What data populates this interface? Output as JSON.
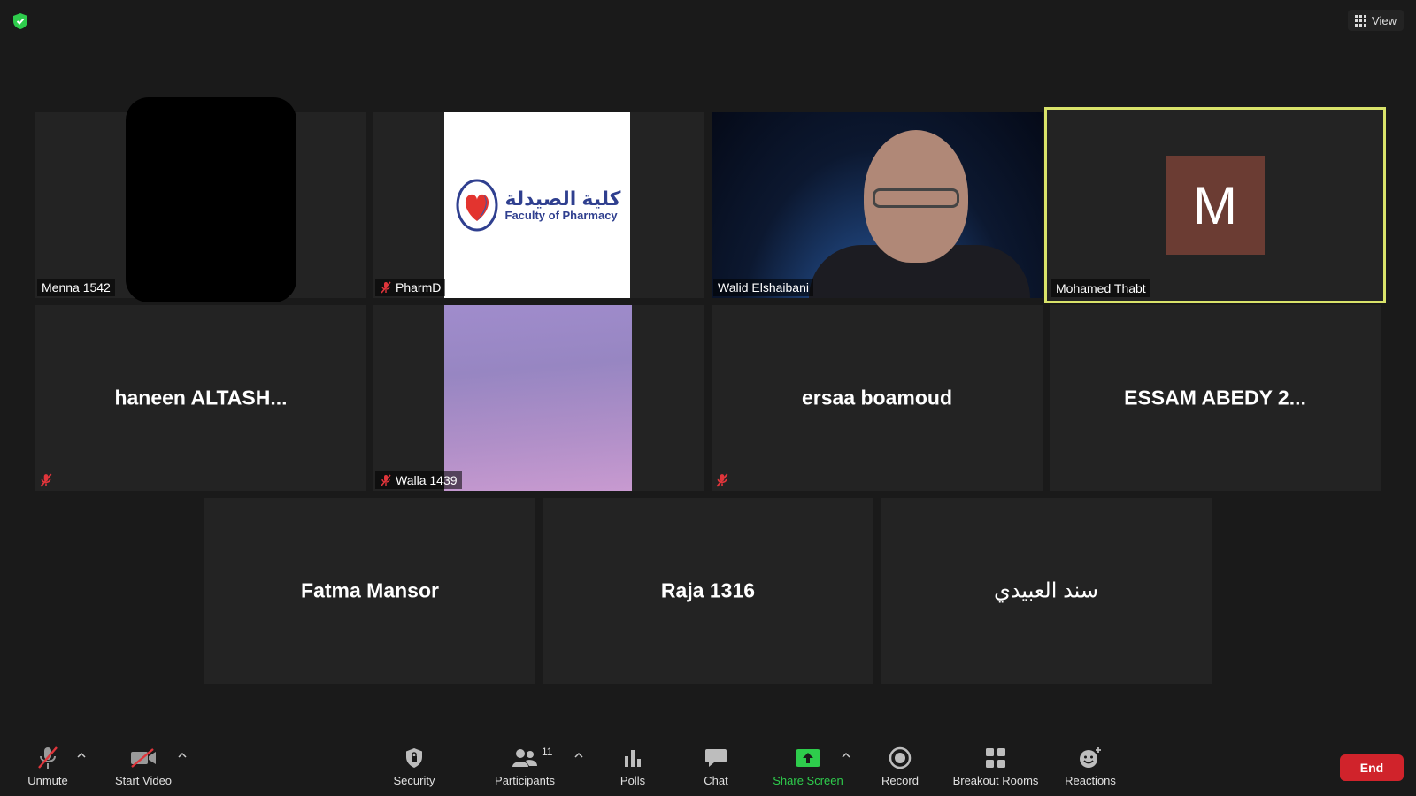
{
  "top": {
    "view_label": "View"
  },
  "tiles": {
    "menna": {
      "name": "Menna 1542"
    },
    "pharmd": {
      "name": "PharmD",
      "logo_ar": "كلية الصيدلة",
      "logo_en": "Faculty of Pharmacy"
    },
    "walid": {
      "name": "Walid Elshaibani"
    },
    "mohamed": {
      "name": "Mohamed Thabt",
      "avatar_letter": "M"
    },
    "haneen": {
      "name": "haneen  ALTASH..."
    },
    "walla": {
      "name": "Walla 1439"
    },
    "ersaa": {
      "name": "ersaa boamoud"
    },
    "essam": {
      "name": "ESSAM  ABEDY  2..."
    },
    "fatma": {
      "name": "Fatma Mansor"
    },
    "raja": {
      "name": "Raja 1316"
    },
    "sanad": {
      "name": "سند العبيدي"
    }
  },
  "toolbar": {
    "unmute": "Unmute",
    "start_video": "Start Video",
    "security": "Security",
    "participants": "Participants",
    "participants_count": "11",
    "polls": "Polls",
    "chat": "Chat",
    "share_screen": "Share Screen",
    "record": "Record",
    "breakout_rooms": "Breakout Rooms",
    "reactions": "Reactions",
    "end": "End"
  },
  "colors": {
    "active_speaker_border": "#d9e36a",
    "share_green": "#2ecc4c",
    "end_red": "#d0232b",
    "mute_red": "#e0353b"
  }
}
